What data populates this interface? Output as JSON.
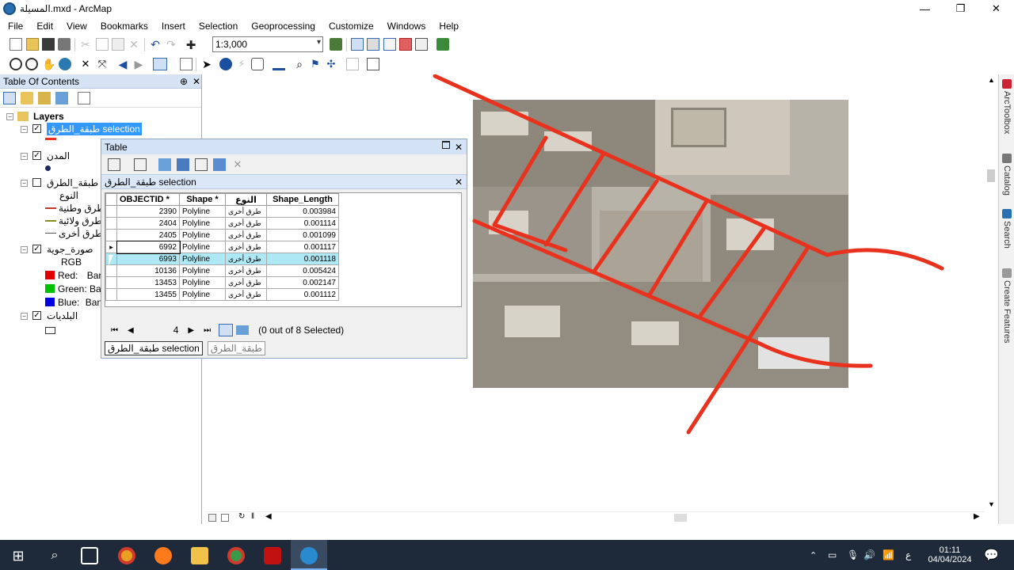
{
  "window": {
    "title": "المسيلة.mxd - ArcMap",
    "minimize": "—",
    "restore": "❐",
    "close": "✕"
  },
  "menu": [
    "File",
    "Edit",
    "View",
    "Bookmarks",
    "Insert",
    "Selection",
    "Geoprocessing",
    "Customize",
    "Windows",
    "Help"
  ],
  "toolbar": {
    "scale": "1:3,000",
    "scale_dropdown": "▾"
  },
  "toc": {
    "title": "Table Of Contents",
    "pin": "⊕",
    "close": "✕",
    "layers_root": "Layers",
    "items": [
      {
        "label": "طبقة_الطرق selection",
        "checked": true,
        "expanded": true,
        "selected": true
      },
      {
        "label": "المدن",
        "checked": true,
        "expanded": true
      },
      {
        "label": "طبقة_الطرق",
        "checked": false,
        "expanded": true,
        "field": "النوع",
        "classes": [
          {
            "label": "طرق وطنية",
            "color": "#c0392b"
          },
          {
            "label": "طرق ولائية",
            "color": "#8a8a1a"
          },
          {
            "label": "طرق أخرى",
            "color": "#555555"
          }
        ]
      },
      {
        "label": "صورة_جوية",
        "checked": true,
        "expanded": true,
        "sub": "RGB",
        "bands": [
          {
            "label": "Red:",
            "band": "Ban",
            "color": "#e00000"
          },
          {
            "label": "Green:",
            "band": "Ban",
            "color": "#00c000"
          },
          {
            "label": "Blue:",
            "band": "Ban",
            "color": "#0000e0"
          }
        ]
      },
      {
        "label": "البلديات",
        "checked": true,
        "expanded": true
      }
    ]
  },
  "table_window": {
    "title": "Table",
    "subtitle": "طبقة_الطرق selection",
    "columns": [
      "OBJECTID *",
      "Shape *",
      "النوع",
      "Shape_Length"
    ],
    "rows": [
      {
        "id": "2390",
        "shape": "Polyline",
        "type": "طرق أخرى",
        "length": "0.003984",
        "selected": false,
        "current": false
      },
      {
        "id": "2404",
        "shape": "Polyline",
        "type": "طرق أخرى",
        "length": "0.001114",
        "selected": false,
        "current": false
      },
      {
        "id": "2405",
        "shape": "Polyline",
        "type": "طرق أخرى",
        "length": "0.001099",
        "selected": false,
        "current": false
      },
      {
        "id": "6992",
        "shape": "Polyline",
        "type": "طرق أخرى",
        "length": "0.001117",
        "selected": false,
        "current": true
      },
      {
        "id": "6993",
        "shape": "Polyline",
        "type": "طرق أخرى",
        "length": "0.001118",
        "selected": true,
        "current": false
      },
      {
        "id": "10136",
        "shape": "Polyline",
        "type": "طرق أخرى",
        "length": "0.005424",
        "selected": false,
        "current": false
      },
      {
        "id": "13453",
        "shape": "Polyline",
        "type": "طرق أخرى",
        "length": "0.002147",
        "selected": false,
        "current": false
      },
      {
        "id": "13455",
        "shape": "Polyline",
        "type": "طرق أخرى",
        "length": "0.001112",
        "selected": false,
        "current": false
      }
    ],
    "current_record": "4",
    "status": "(0 out of 8 Selected)",
    "tabs": [
      "طبقة_الطرق selection",
      "طبقة_الطرق"
    ]
  },
  "right_tabs": [
    "ArcToolbox",
    "Catalog",
    "Search",
    "Create Features"
  ],
  "taskbar": {
    "time": "01:11",
    "date": "04/04/2024",
    "lang": "ع"
  },
  "colors": {
    "road": "#e8321e",
    "selection_row": "#aee8f5",
    "toc_selected": "#3399ff"
  }
}
